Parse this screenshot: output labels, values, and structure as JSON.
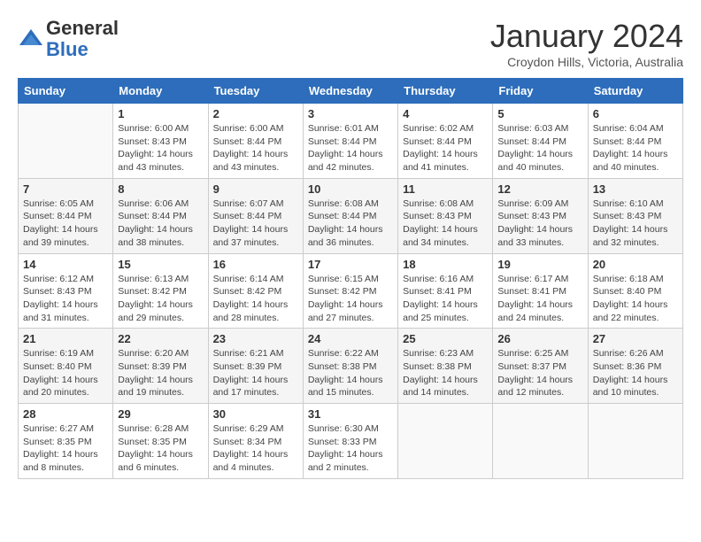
{
  "logo": {
    "general": "General",
    "blue": "Blue"
  },
  "header": {
    "month": "January 2024",
    "location": "Croydon Hills, Victoria, Australia"
  },
  "weekdays": [
    "Sunday",
    "Monday",
    "Tuesday",
    "Wednesday",
    "Thursday",
    "Friday",
    "Saturday"
  ],
  "weeks": [
    [
      {
        "day": "",
        "info": ""
      },
      {
        "day": "1",
        "info": "Sunrise: 6:00 AM\nSunset: 8:43 PM\nDaylight: 14 hours\nand 43 minutes."
      },
      {
        "day": "2",
        "info": "Sunrise: 6:00 AM\nSunset: 8:44 PM\nDaylight: 14 hours\nand 43 minutes."
      },
      {
        "day": "3",
        "info": "Sunrise: 6:01 AM\nSunset: 8:44 PM\nDaylight: 14 hours\nand 42 minutes."
      },
      {
        "day": "4",
        "info": "Sunrise: 6:02 AM\nSunset: 8:44 PM\nDaylight: 14 hours\nand 41 minutes."
      },
      {
        "day": "5",
        "info": "Sunrise: 6:03 AM\nSunset: 8:44 PM\nDaylight: 14 hours\nand 40 minutes."
      },
      {
        "day": "6",
        "info": "Sunrise: 6:04 AM\nSunset: 8:44 PM\nDaylight: 14 hours\nand 40 minutes."
      }
    ],
    [
      {
        "day": "7",
        "info": "Sunrise: 6:05 AM\nSunset: 8:44 PM\nDaylight: 14 hours\nand 39 minutes."
      },
      {
        "day": "8",
        "info": "Sunrise: 6:06 AM\nSunset: 8:44 PM\nDaylight: 14 hours\nand 38 minutes."
      },
      {
        "day": "9",
        "info": "Sunrise: 6:07 AM\nSunset: 8:44 PM\nDaylight: 14 hours\nand 37 minutes."
      },
      {
        "day": "10",
        "info": "Sunrise: 6:08 AM\nSunset: 8:44 PM\nDaylight: 14 hours\nand 36 minutes."
      },
      {
        "day": "11",
        "info": "Sunrise: 6:08 AM\nSunset: 8:43 PM\nDaylight: 14 hours\nand 34 minutes."
      },
      {
        "day": "12",
        "info": "Sunrise: 6:09 AM\nSunset: 8:43 PM\nDaylight: 14 hours\nand 33 minutes."
      },
      {
        "day": "13",
        "info": "Sunrise: 6:10 AM\nSunset: 8:43 PM\nDaylight: 14 hours\nand 32 minutes."
      }
    ],
    [
      {
        "day": "14",
        "info": "Sunrise: 6:12 AM\nSunset: 8:43 PM\nDaylight: 14 hours\nand 31 minutes."
      },
      {
        "day": "15",
        "info": "Sunrise: 6:13 AM\nSunset: 8:42 PM\nDaylight: 14 hours\nand 29 minutes."
      },
      {
        "day": "16",
        "info": "Sunrise: 6:14 AM\nSunset: 8:42 PM\nDaylight: 14 hours\nand 28 minutes."
      },
      {
        "day": "17",
        "info": "Sunrise: 6:15 AM\nSunset: 8:42 PM\nDaylight: 14 hours\nand 27 minutes."
      },
      {
        "day": "18",
        "info": "Sunrise: 6:16 AM\nSunset: 8:41 PM\nDaylight: 14 hours\nand 25 minutes."
      },
      {
        "day": "19",
        "info": "Sunrise: 6:17 AM\nSunset: 8:41 PM\nDaylight: 14 hours\nand 24 minutes."
      },
      {
        "day": "20",
        "info": "Sunrise: 6:18 AM\nSunset: 8:40 PM\nDaylight: 14 hours\nand 22 minutes."
      }
    ],
    [
      {
        "day": "21",
        "info": "Sunrise: 6:19 AM\nSunset: 8:40 PM\nDaylight: 14 hours\nand 20 minutes."
      },
      {
        "day": "22",
        "info": "Sunrise: 6:20 AM\nSunset: 8:39 PM\nDaylight: 14 hours\nand 19 minutes."
      },
      {
        "day": "23",
        "info": "Sunrise: 6:21 AM\nSunset: 8:39 PM\nDaylight: 14 hours\nand 17 minutes."
      },
      {
        "day": "24",
        "info": "Sunrise: 6:22 AM\nSunset: 8:38 PM\nDaylight: 14 hours\nand 15 minutes."
      },
      {
        "day": "25",
        "info": "Sunrise: 6:23 AM\nSunset: 8:38 PM\nDaylight: 14 hours\nand 14 minutes."
      },
      {
        "day": "26",
        "info": "Sunrise: 6:25 AM\nSunset: 8:37 PM\nDaylight: 14 hours\nand 12 minutes."
      },
      {
        "day": "27",
        "info": "Sunrise: 6:26 AM\nSunset: 8:36 PM\nDaylight: 14 hours\nand 10 minutes."
      }
    ],
    [
      {
        "day": "28",
        "info": "Sunrise: 6:27 AM\nSunset: 8:35 PM\nDaylight: 14 hours\nand 8 minutes."
      },
      {
        "day": "29",
        "info": "Sunrise: 6:28 AM\nSunset: 8:35 PM\nDaylight: 14 hours\nand 6 minutes."
      },
      {
        "day": "30",
        "info": "Sunrise: 6:29 AM\nSunset: 8:34 PM\nDaylight: 14 hours\nand 4 minutes."
      },
      {
        "day": "31",
        "info": "Sunrise: 6:30 AM\nSunset: 8:33 PM\nDaylight: 14 hours\nand 2 minutes."
      },
      {
        "day": "",
        "info": ""
      },
      {
        "day": "",
        "info": ""
      },
      {
        "day": "",
        "info": ""
      }
    ]
  ]
}
